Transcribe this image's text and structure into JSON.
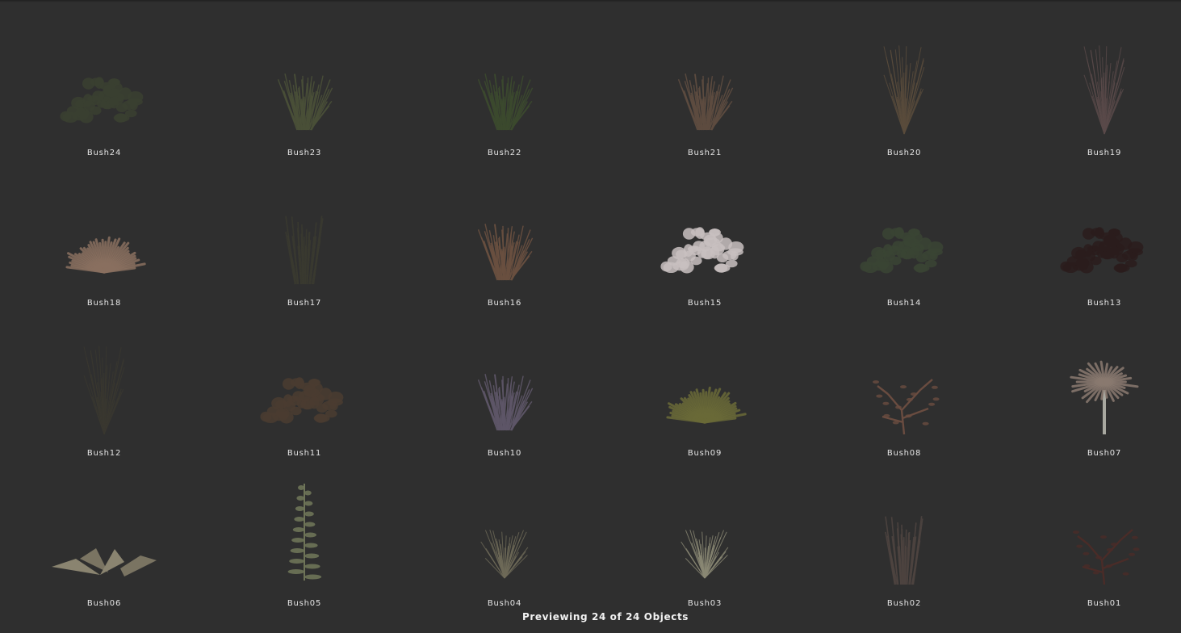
{
  "browser": {
    "status_text": "Previewing 24 of 24 Objects",
    "objects": [
      {
        "name": "Bush24",
        "style": "leafy",
        "color": "#3a4030"
      },
      {
        "name": "Bush23",
        "style": "grass",
        "color": "#4a5038"
      },
      {
        "name": "Bush22",
        "style": "grass",
        "color": "#3c4a2e"
      },
      {
        "name": "Bush21",
        "style": "grass",
        "color": "#5e4c40"
      },
      {
        "name": "Bush20",
        "style": "twig",
        "color": "#5a4c3c"
      },
      {
        "name": "Bush19",
        "style": "twig",
        "color": "#5a4a4a"
      },
      {
        "name": "Bush18",
        "style": "fan",
        "color": "#8a7060"
      },
      {
        "name": "Bush17",
        "style": "reeds",
        "color": "#3a3a30"
      },
      {
        "name": "Bush16",
        "style": "grass",
        "color": "#6a5040"
      },
      {
        "name": "Bush15",
        "style": "leafy",
        "color": "#c8c0c0"
      },
      {
        "name": "Bush14",
        "style": "leafy",
        "color": "#3a4434"
      },
      {
        "name": "Bush13",
        "style": "leafy",
        "color": "#2a1c1c"
      },
      {
        "name": "Bush12",
        "style": "twig",
        "color": "#3a3830"
      },
      {
        "name": "Bush11",
        "style": "leafy",
        "color": "#4a3c30"
      },
      {
        "name": "Bush10",
        "style": "grass",
        "color": "#5e5668"
      },
      {
        "name": "Bush09",
        "style": "fan",
        "color": "#6a6a38"
      },
      {
        "name": "Bush08",
        "style": "branch",
        "color": "#6a4c40"
      },
      {
        "name": "Bush07",
        "style": "palm",
        "color": "#8a7a70"
      },
      {
        "name": "Bush06",
        "style": "flat",
        "color": "#8a8470"
      },
      {
        "name": "Bush05",
        "style": "stalk",
        "color": "#6e7458"
      },
      {
        "name": "Bush04",
        "style": "tuft",
        "color": "#6e6a58"
      },
      {
        "name": "Bush03",
        "style": "tuft",
        "color": "#8a8874"
      },
      {
        "name": "Bush02",
        "style": "reeds",
        "color": "#4e4440"
      },
      {
        "name": "Bush01",
        "style": "branch",
        "color": "#4a2c28"
      }
    ]
  }
}
